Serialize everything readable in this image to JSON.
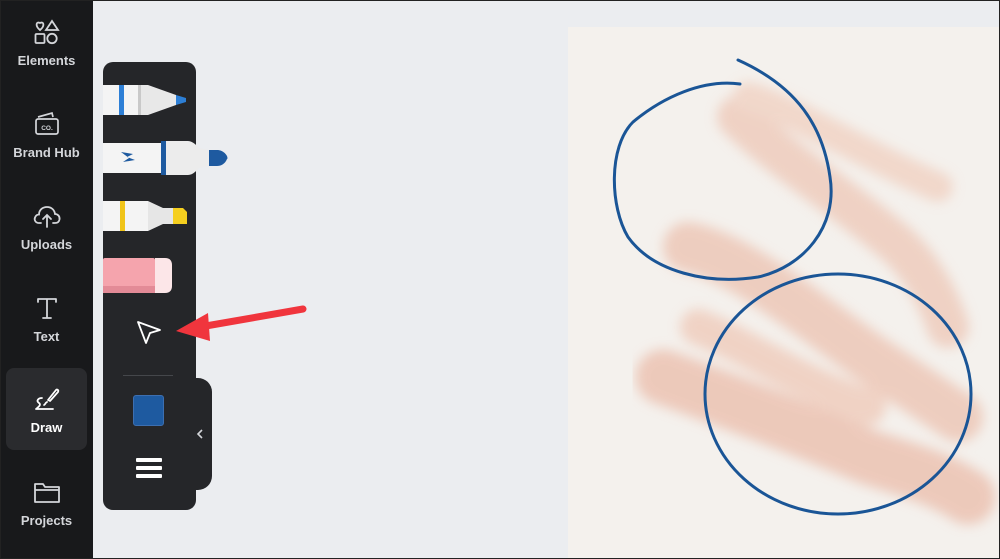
{
  "sidebar": {
    "items": [
      {
        "label": "Elements",
        "icon": "elements-icon",
        "active": false
      },
      {
        "label": "Brand Hub",
        "icon": "brand-hub-icon",
        "badge": "CO.",
        "active": false
      },
      {
        "label": "Uploads",
        "icon": "upload-cloud-icon",
        "active": false
      },
      {
        "label": "Text",
        "icon": "text-icon",
        "active": false
      },
      {
        "label": "Draw",
        "icon": "draw-icon",
        "active": true
      },
      {
        "label": "Projects",
        "icon": "folder-icon",
        "active": false
      }
    ]
  },
  "draw_panel": {
    "tools": [
      {
        "name": "pen",
        "icon": "pen-icon"
      },
      {
        "name": "marker",
        "icon": "marker-icon"
      },
      {
        "name": "highlighter",
        "icon": "highlighter-icon"
      },
      {
        "name": "eraser",
        "icon": "eraser-icon"
      },
      {
        "name": "select",
        "icon": "cursor-arrow-icon"
      }
    ],
    "current_color": "#1e5aa0",
    "menu_icon": "hamburger-menu-icon",
    "collapse_icon": "chevron-left-icon"
  },
  "colors": {
    "sidebar_bg": "#18191b",
    "panel_bg": "#252629",
    "stroke_blue": "#1a5596",
    "annotation_arrow": "#f0353d",
    "canvas_bg": "#f4f1ed"
  }
}
